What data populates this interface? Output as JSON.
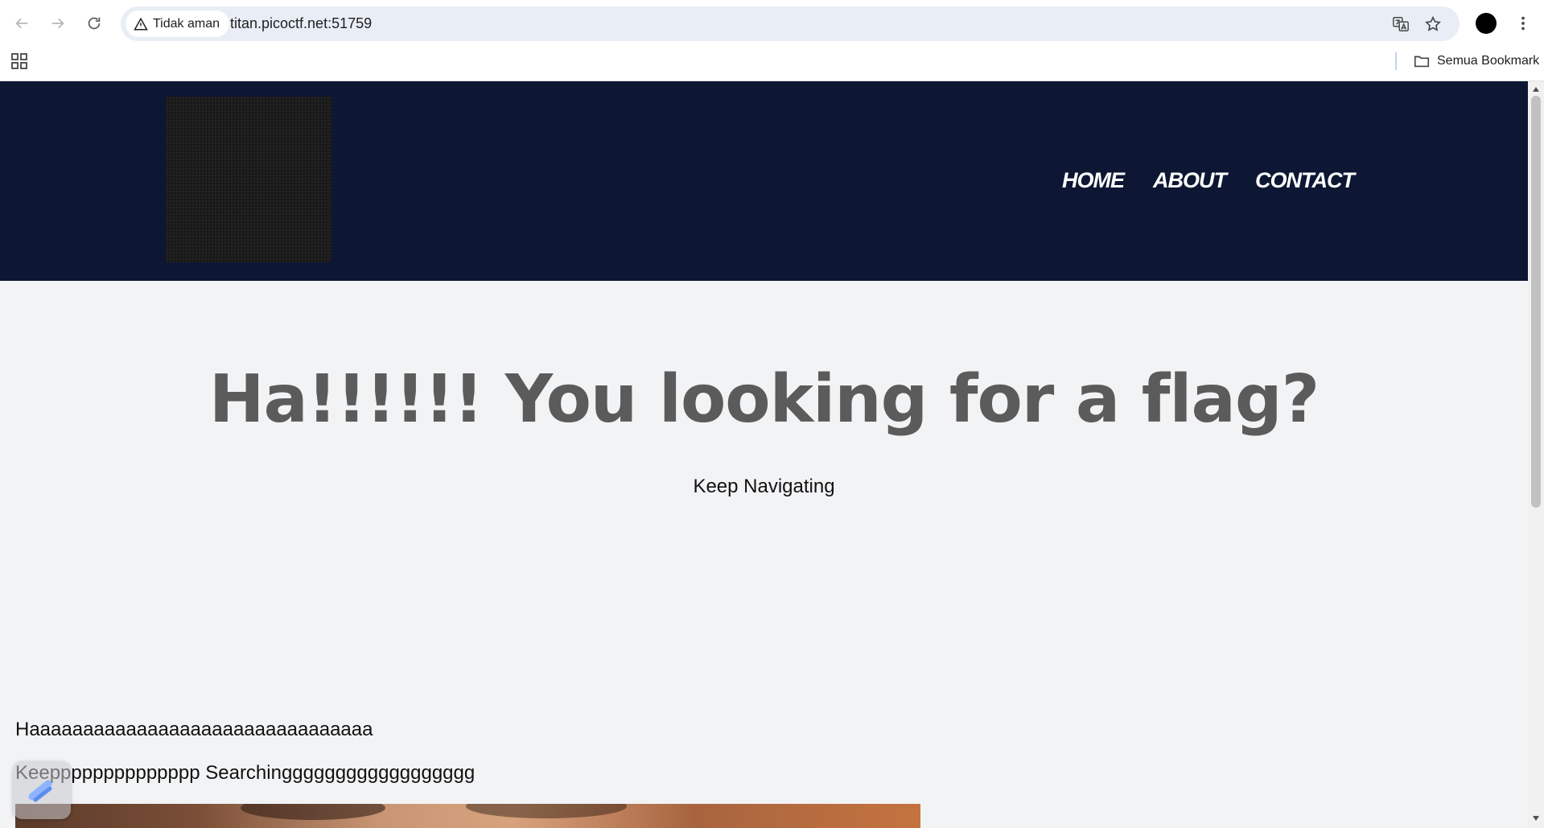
{
  "browser": {
    "security_label": "Tidak aman",
    "url": "titan.picoctf.net:51759",
    "bookmarks_label": "Semua Bookmark"
  },
  "site": {
    "nav": [
      "HOME",
      "ABOUT",
      "CONTACT"
    ],
    "heading": "Ha!!!!!! You looking for a flag?",
    "subheading": "Keep Navigating",
    "line1": "Haaaaaaaaaaaaaaaaaaaaaaaaaaaaaaaa",
    "line2": "Keepppppppppppppp Searchingggggggggggggggggg"
  },
  "colors": {
    "header_bg": "#0d1733",
    "page_bg": "#f2f3f5",
    "heading_text": "#5b5b5b",
    "omnibox_bg": "#e9eef6"
  }
}
